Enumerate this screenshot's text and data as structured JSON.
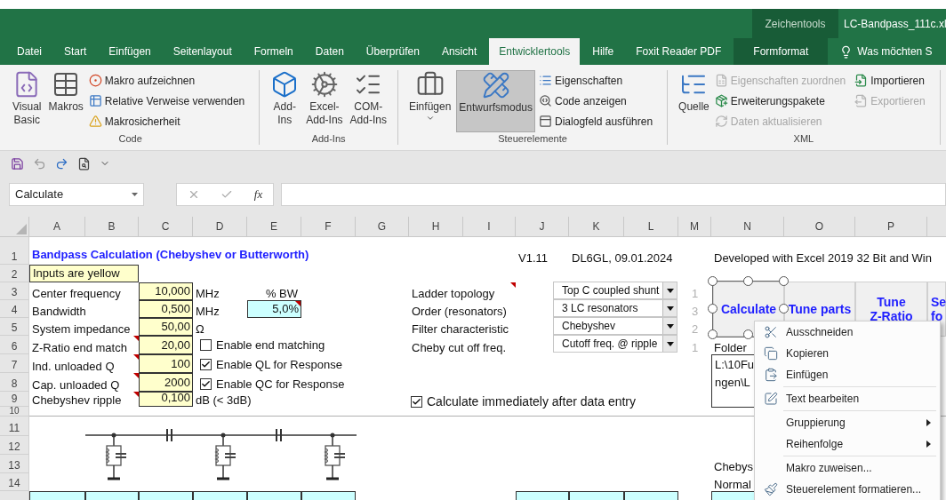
{
  "window": {
    "contextual_group": "Zeichentools",
    "file_title": "LC-Bandpass_111c.xl"
  },
  "tabs": [
    {
      "label": "Datei",
      "selected": false,
      "kind": "normal"
    },
    {
      "label": "Start",
      "selected": false,
      "kind": "normal"
    },
    {
      "label": "Einfügen",
      "selected": false,
      "kind": "normal"
    },
    {
      "label": "Seitenlayout",
      "selected": false,
      "kind": "normal"
    },
    {
      "label": "Formeln",
      "selected": false,
      "kind": "normal"
    },
    {
      "label": "Daten",
      "selected": false,
      "kind": "normal"
    },
    {
      "label": "Überprüfen",
      "selected": false,
      "kind": "normal"
    },
    {
      "label": "Ansicht",
      "selected": false,
      "kind": "normal"
    },
    {
      "label": "Entwicklertools",
      "selected": true,
      "kind": "normal"
    },
    {
      "label": "Hilfe",
      "selected": false,
      "kind": "normal"
    },
    {
      "label": "Foxit Reader PDF",
      "selected": false,
      "kind": "normal"
    },
    {
      "label": "Formformat",
      "selected": false,
      "kind": "contextual"
    }
  ],
  "tell_me": {
    "text": "Was möchten S"
  },
  "ribbon": {
    "groups": [
      {
        "label": "Code",
        "large": [
          {
            "lines": [
              "Visual",
              "Basic"
            ],
            "pressed": false,
            "has_menu": false
          },
          {
            "lines": [
              "Makros"
            ],
            "pressed": false,
            "has_menu": false
          }
        ],
        "small_columns": [
          [
            {
              "label": "Makro aufzeichnen",
              "disabled": false
            },
            {
              "label": "Relative Verweise verwenden",
              "disabled": false
            },
            {
              "label": "Makrosicherheit",
              "disabled": false
            }
          ]
        ]
      },
      {
        "label": "Add-Ins",
        "large": [
          {
            "lines": [
              "Add-",
              "Ins"
            ],
            "pressed": false,
            "has_menu": false
          },
          {
            "lines": [
              "Excel-",
              "Add-Ins"
            ],
            "pressed": false,
            "has_menu": false
          },
          {
            "lines": [
              "COM-",
              "Add-Ins"
            ],
            "pressed": false,
            "has_menu": false
          }
        ]
      },
      {
        "label": "Steuerelemente",
        "large": [
          {
            "lines": [
              "Einfügen"
            ],
            "pressed": false,
            "has_menu": true
          },
          {
            "lines": [
              "Entwurfsmodus"
            ],
            "pressed": true,
            "has_menu": false
          }
        ],
        "small_columns": [
          [
            {
              "label": "Eigenschaften",
              "disabled": false
            },
            {
              "label": "Code anzeigen",
              "disabled": false
            },
            {
              "label": "Dialogfeld ausführen",
              "disabled": false
            }
          ]
        ]
      },
      {
        "label": "XML",
        "large": [
          {
            "lines": [
              "Quelle"
            ],
            "pressed": false,
            "has_menu": false
          }
        ],
        "small_columns": [
          [
            {
              "label": "Eigenschaften zuordnen",
              "disabled": true
            },
            {
              "label": "Erweiterungspakete",
              "disabled": false
            },
            {
              "label": "Daten aktualisieren",
              "disabled": true
            }
          ],
          [
            {
              "label": "Importieren",
              "disabled": false
            },
            {
              "label": "Exportieren",
              "disabled": true
            }
          ]
        ]
      }
    ]
  },
  "formula_bar": {
    "name_box": "Calculate",
    "function_label": "fx"
  },
  "sheet": {
    "columns": [
      "A",
      "B",
      "C",
      "D",
      "E",
      "F",
      "G",
      "H",
      "I",
      "J",
      "K",
      "L",
      "M",
      "N",
      "O",
      "P"
    ],
    "rows": [
      {
        "number": "1",
        "cells": [
          {
            "text": "Bandpass Calculation (Chebyshev or Butterworth)",
            "kind": "title"
          },
          "",
          "",
          "",
          "",
          "",
          "",
          "",
          "",
          {
            "text": "V1.11",
            "kind": "label"
          },
          {
            "text": "DL6GL, 09.01.2024",
            "kind": "label"
          },
          "",
          "",
          {
            "text": "Developed with Excel 2019 32 Bit and Win",
            "kind": "label"
          }
        ]
      },
      {
        "number": "2",
        "cells": [
          {
            "text": "Inputs are yellow",
            "kind": "legend"
          },
          {
            "kind": "legend_fill"
          }
        ]
      },
      {
        "number": "3",
        "cells": [
          {
            "text": "Center frequency",
            "kind": "label"
          },
          "",
          {
            "text": "10,000",
            "kind": "input"
          },
          {
            "text": "MHz",
            "kind": "label"
          },
          {
            "text": "% BW",
            "kind": "caption"
          },
          "",
          "",
          {
            "text": "Ladder topology",
            "kind": "label"
          },
          {
            "kind": "blank",
            "comment": true
          },
          "",
          "",
          "",
          {
            "text": "1",
            "kind": "faint"
          }
        ]
      },
      {
        "number": "4",
        "cells": [
          {
            "text": "Bandwidth",
            "kind": "label"
          },
          "",
          {
            "text": "0,500",
            "kind": "input"
          },
          {
            "text": "MHz",
            "kind": "label"
          },
          {
            "text": "5,0%",
            "kind": "output",
            "comment": true
          },
          "",
          "",
          {
            "text": "Order (resonators)",
            "kind": "label"
          },
          "",
          "",
          "",
          "",
          {
            "text": "3",
            "kind": "faint"
          }
        ]
      },
      {
        "number": "5",
        "cells": [
          {
            "text": "System impedance",
            "kind": "label"
          },
          "",
          {
            "text": "50,00",
            "kind": "input"
          },
          {
            "text": "Ω",
            "kind": "label"
          },
          "",
          "",
          "",
          {
            "text": "Filter characteristic",
            "kind": "label"
          },
          "",
          "",
          "",
          "",
          {
            "text": "2",
            "kind": "faint"
          }
        ]
      },
      {
        "number": "6",
        "cells": [
          {
            "text": "Z-Ratio end match",
            "kind": "label"
          },
          {
            "kind": "blank",
            "comment": true
          },
          {
            "text": "20,00",
            "kind": "input"
          },
          "",
          "",
          "",
          "",
          {
            "text": "Cheby cut off freq.",
            "kind": "label"
          },
          "",
          "",
          "",
          "",
          {
            "text": "1",
            "kind": "faint"
          },
          {
            "text": "Folder",
            "kind": "label"
          }
        ]
      },
      {
        "number": "7",
        "cells": [
          {
            "text": "Ind. unloaded Q",
            "kind": "label"
          },
          {
            "kind": "blank",
            "comment": true
          },
          {
            "text": "100",
            "kind": "input"
          }
        ]
      },
      {
        "number": "8",
        "cells": [
          {
            "text": "Cap. unloaded Q",
            "kind": "label"
          },
          {
            "kind": "blank",
            "comment": true
          },
          {
            "text": "2000",
            "kind": "input"
          }
        ]
      },
      {
        "number": "9",
        "cells": [
          {
            "text": "Chebyshev ripple",
            "kind": "label"
          },
          {
            "kind": "blank",
            "comment": true
          },
          {
            "text": "0,100",
            "kind": "input"
          },
          {
            "text": "dB (< 3dB)",
            "kind": "label"
          }
        ]
      },
      {
        "number": "10",
        "cells": []
      },
      {
        "number": "11",
        "cells": []
      },
      {
        "number": "12",
        "cells": []
      },
      {
        "number": "13",
        "cells": [
          "",
          "",
          "",
          "",
          "",
          "",
          "",
          "",
          "",
          "",
          "",
          "",
          "",
          {
            "text": "Chebys",
            "kind": "label"
          }
        ]
      },
      {
        "number": "14",
        "cells": [
          "",
          "",
          "",
          "",
          "",
          "",
          "",
          "",
          "",
          "",
          "",
          "",
          "",
          {
            "text": "Normal",
            "kind": "label"
          }
        ]
      },
      {
        "cells": [
          {
            "kind": "output"
          },
          {
            "kind": "output"
          },
          {
            "kind": "output"
          },
          {
            "kind": "output"
          },
          {
            "kind": "output"
          },
          {
            "kind": "output"
          },
          "",
          "",
          "",
          {
            "kind": "output"
          },
          {
            "kind": "output"
          },
          {
            "kind": "output"
          },
          "",
          {
            "kind": "output"
          }
        ]
      }
    ]
  },
  "checkboxes": [
    {
      "label": "Enable end matching",
      "checked": false,
      "kind": "small"
    },
    {
      "label": "Enable QL for Response",
      "checked": true,
      "kind": "small"
    },
    {
      "label": "Enable QC for Response",
      "checked": true,
      "kind": "small"
    },
    {
      "label": "Calculate immediately after data entry",
      "checked": true,
      "kind": "large"
    }
  ],
  "dropdowns": [
    {
      "value": "Top C coupled shunt"
    },
    {
      "value": "3 LC resonators"
    },
    {
      "value": "Chebyshev"
    },
    {
      "value": "Cutoff freq. @ ripple"
    }
  ],
  "buttons": [
    {
      "lines": [
        "Calculate"
      ],
      "selected": true
    },
    {
      "lines": [
        "Tune parts"
      ],
      "selected": false
    },
    {
      "lines": [
        "Tune",
        "Z-Ratio"
      ],
      "selected": false
    },
    {
      "lines": [
        "Se",
        "fo"
      ],
      "selected": false
    }
  ],
  "path_box": {
    "lines": [
      "L:\\10Fu",
      "ngen\\L"
    ]
  },
  "context_menu": [
    {
      "kind": "item",
      "label": "Ausschneiden"
    },
    {
      "kind": "item",
      "label": "Kopieren"
    },
    {
      "kind": "item",
      "label": "Einfügen"
    },
    {
      "kind": "separator"
    },
    {
      "kind": "item",
      "label": "Text bearbeiten"
    },
    {
      "kind": "separator"
    },
    {
      "kind": "submenu",
      "label": "Gruppierung"
    },
    {
      "kind": "submenu",
      "label": "Reihenfolge"
    },
    {
      "kind": "separator"
    },
    {
      "kind": "item",
      "label": "Makro zuweisen..."
    },
    {
      "kind": "item",
      "label": "Steuerelement formatieren..."
    }
  ]
}
